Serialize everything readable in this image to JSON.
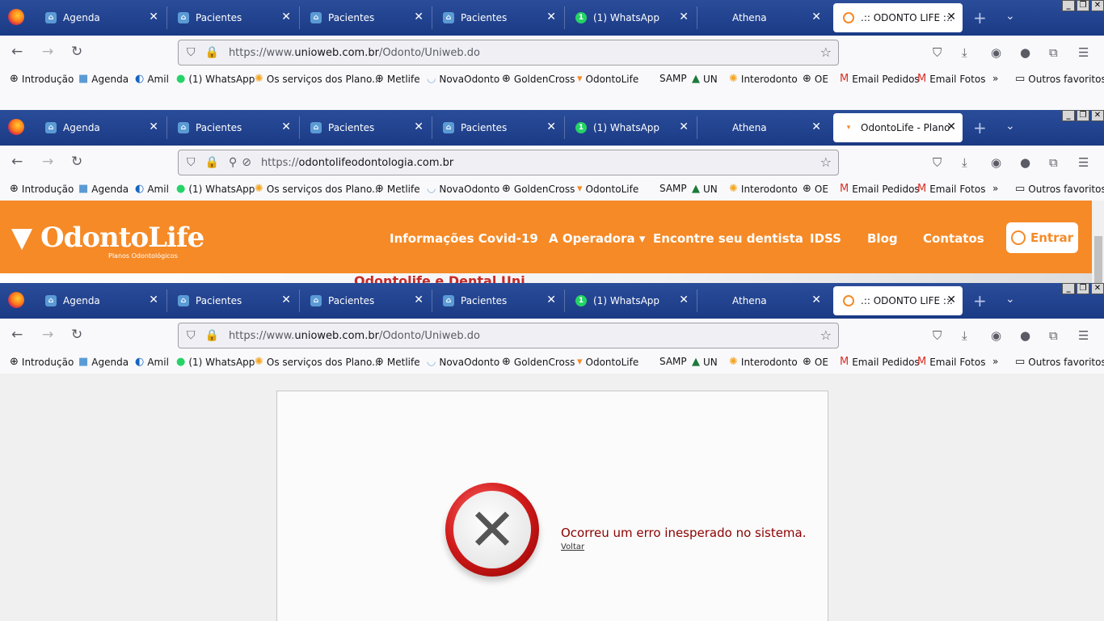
{
  "windows": [
    {
      "tabs": [
        {
          "label": "Agenda",
          "icon": "tooth-icon"
        },
        {
          "label": "Pacientes",
          "icon": "tooth-icon"
        },
        {
          "label": "Pacientes",
          "icon": "tooth-icon"
        },
        {
          "label": "Pacientes",
          "icon": "tooth-icon"
        },
        {
          "label": "(1) WhatsApp",
          "icon": "whatsapp-icon"
        },
        {
          "label": "Athena",
          "icon": ""
        },
        {
          "label": ".:: ODONTO LIFE ::.",
          "icon": "odontolife-icon",
          "active": true
        }
      ],
      "url_prefix": "https://www.",
      "url_host": "unioweb.com.br",
      "url_path": "/Odonto/Uniweb.do"
    },
    {
      "tabs": [
        {
          "label": "Agenda",
          "icon": "tooth-icon"
        },
        {
          "label": "Pacientes",
          "icon": "tooth-icon"
        },
        {
          "label": "Pacientes",
          "icon": "tooth-icon"
        },
        {
          "label": "Pacientes",
          "icon": "tooth-icon"
        },
        {
          "label": "(1) WhatsApp",
          "icon": "whatsapp-icon"
        },
        {
          "label": "Athena",
          "icon": ""
        },
        {
          "label": "OdontoLife - Plano Od",
          "icon": "odontolife-icon",
          "active": true
        }
      ],
      "url_prefix": "https://",
      "url_host": "odontolifeodontologia.com.br",
      "url_path": ""
    },
    {
      "tabs": [
        {
          "label": "Agenda",
          "icon": "tooth-icon"
        },
        {
          "label": "Pacientes",
          "icon": "tooth-icon"
        },
        {
          "label": "Pacientes",
          "icon": "tooth-icon"
        },
        {
          "label": "Pacientes",
          "icon": "tooth-icon"
        },
        {
          "label": "(1) WhatsApp",
          "icon": "whatsapp-icon"
        },
        {
          "label": "Athena",
          "icon": ""
        },
        {
          "label": ".:: ODONTO LIFE ::.",
          "icon": "odontolife-icon",
          "active": true
        }
      ],
      "url_prefix": "https://www.",
      "url_host": "unioweb.com.br",
      "url_path": "/Odonto/Uniweb.do"
    }
  ],
  "bookmarks": [
    {
      "label": "Introdução",
      "icon": "globe-icon"
    },
    {
      "label": "Agenda",
      "icon": "tooth-icon"
    },
    {
      "label": "Amil",
      "icon": "amil-icon"
    },
    {
      "label": "(1) WhatsApp",
      "icon": "whatsapp-icon"
    },
    {
      "label": "Os serviços dos Plano...",
      "icon": "sun-icon"
    },
    {
      "label": "Metlife",
      "icon": "globe-icon"
    },
    {
      "label": "NovaOdonto",
      "icon": "tooth-icon"
    },
    {
      "label": "GoldenCross",
      "icon": "globe-icon"
    },
    {
      "label": "OdontoLife",
      "icon": "odontolife-icon"
    },
    {
      "label": "SAMP",
      "icon": ""
    },
    {
      "label": "UN",
      "icon": "un-icon"
    },
    {
      "label": "Interodonto",
      "icon": "sun-icon"
    },
    {
      "label": "OE",
      "icon": "globe-icon"
    },
    {
      "label": "Email Pedidos",
      "icon": "gmail-icon"
    },
    {
      "label": "Email Fotos",
      "icon": "gmail-icon"
    }
  ],
  "bookmarks_more": "»",
  "bookmarks_other": "Outros favoritos",
  "odontolife_site": {
    "logo_text": "OdontoLife",
    "logo_sub": "Planos Odontológicos",
    "nav": [
      "Informações Covid-19",
      "A Operadora",
      "Encontre seu dentista",
      "IDSS",
      "Blog",
      "Contatos"
    ],
    "login_button": "Entrar",
    "hero_fragment": "Odontolife e Dental Uni",
    "brand_color": "#f58a27"
  },
  "error_page": {
    "message": "Ocorreu um erro inesperado no sistema.",
    "back_link": "Voltar",
    "message_color": "#8b0000"
  }
}
